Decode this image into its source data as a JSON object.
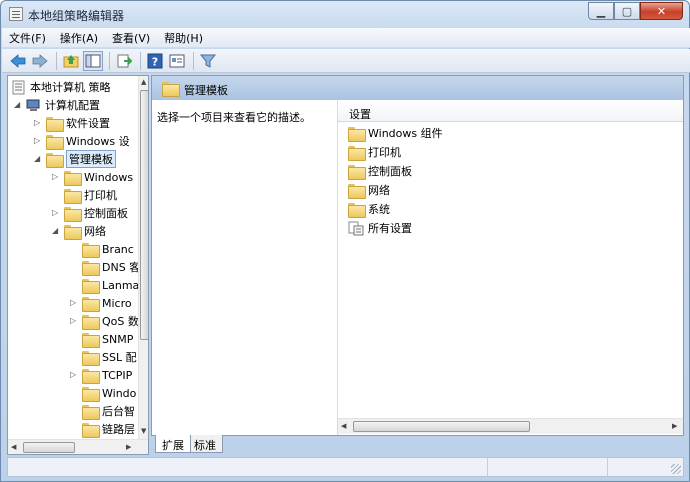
{
  "window": {
    "title": "本地组策略编辑器"
  },
  "caption": {
    "min_icon": "minimize-icon",
    "max_icon": "maximize-icon",
    "close_icon": "close-icon"
  },
  "menu": [
    "文件(F)",
    "操作(A)",
    "查看(V)",
    "帮助(H)"
  ],
  "toolbar": {
    "icons": [
      "back-arrow-icon",
      "forward-arrow-icon",
      "up-folder-icon",
      "show-hide-tree-icon",
      "export-list-icon",
      "help-icon",
      "properties-icon",
      "filter-icon"
    ]
  },
  "tree": {
    "root": "本地计算机 策略",
    "computer_config": "计算机配置",
    "software_settings": "软件设置",
    "windows_settings": "Windows 设",
    "admin_templates": "管理模板",
    "windows_components": "Windows",
    "printers": "打印机",
    "control_panel": "控制面板",
    "network": "网络",
    "branch": "Branc",
    "dns": "DNS 客",
    "lanman": "Lanma",
    "microsoft": "Micro",
    "qos": "QoS 数",
    "snmp": "SNMP",
    "ssl": "SSL 配",
    "tcpip": "TCPIP",
    "windows_connect": "Windo",
    "background": "后台智",
    "link_layer": "链路层"
  },
  "right_pane": {
    "header_title": "管理模板",
    "description": "选择一个项目来查看它的描述。",
    "column_header": "设置",
    "items": [
      "Windows 组件",
      "打印机",
      "控制面板",
      "网络",
      "系统",
      "所有设置"
    ]
  },
  "tabs": [
    "扩展",
    "标准"
  ],
  "colors": {
    "header_blue": "#aac3e1",
    "folder_yellow": "#ecc95b",
    "selection": "#ddecfd"
  }
}
